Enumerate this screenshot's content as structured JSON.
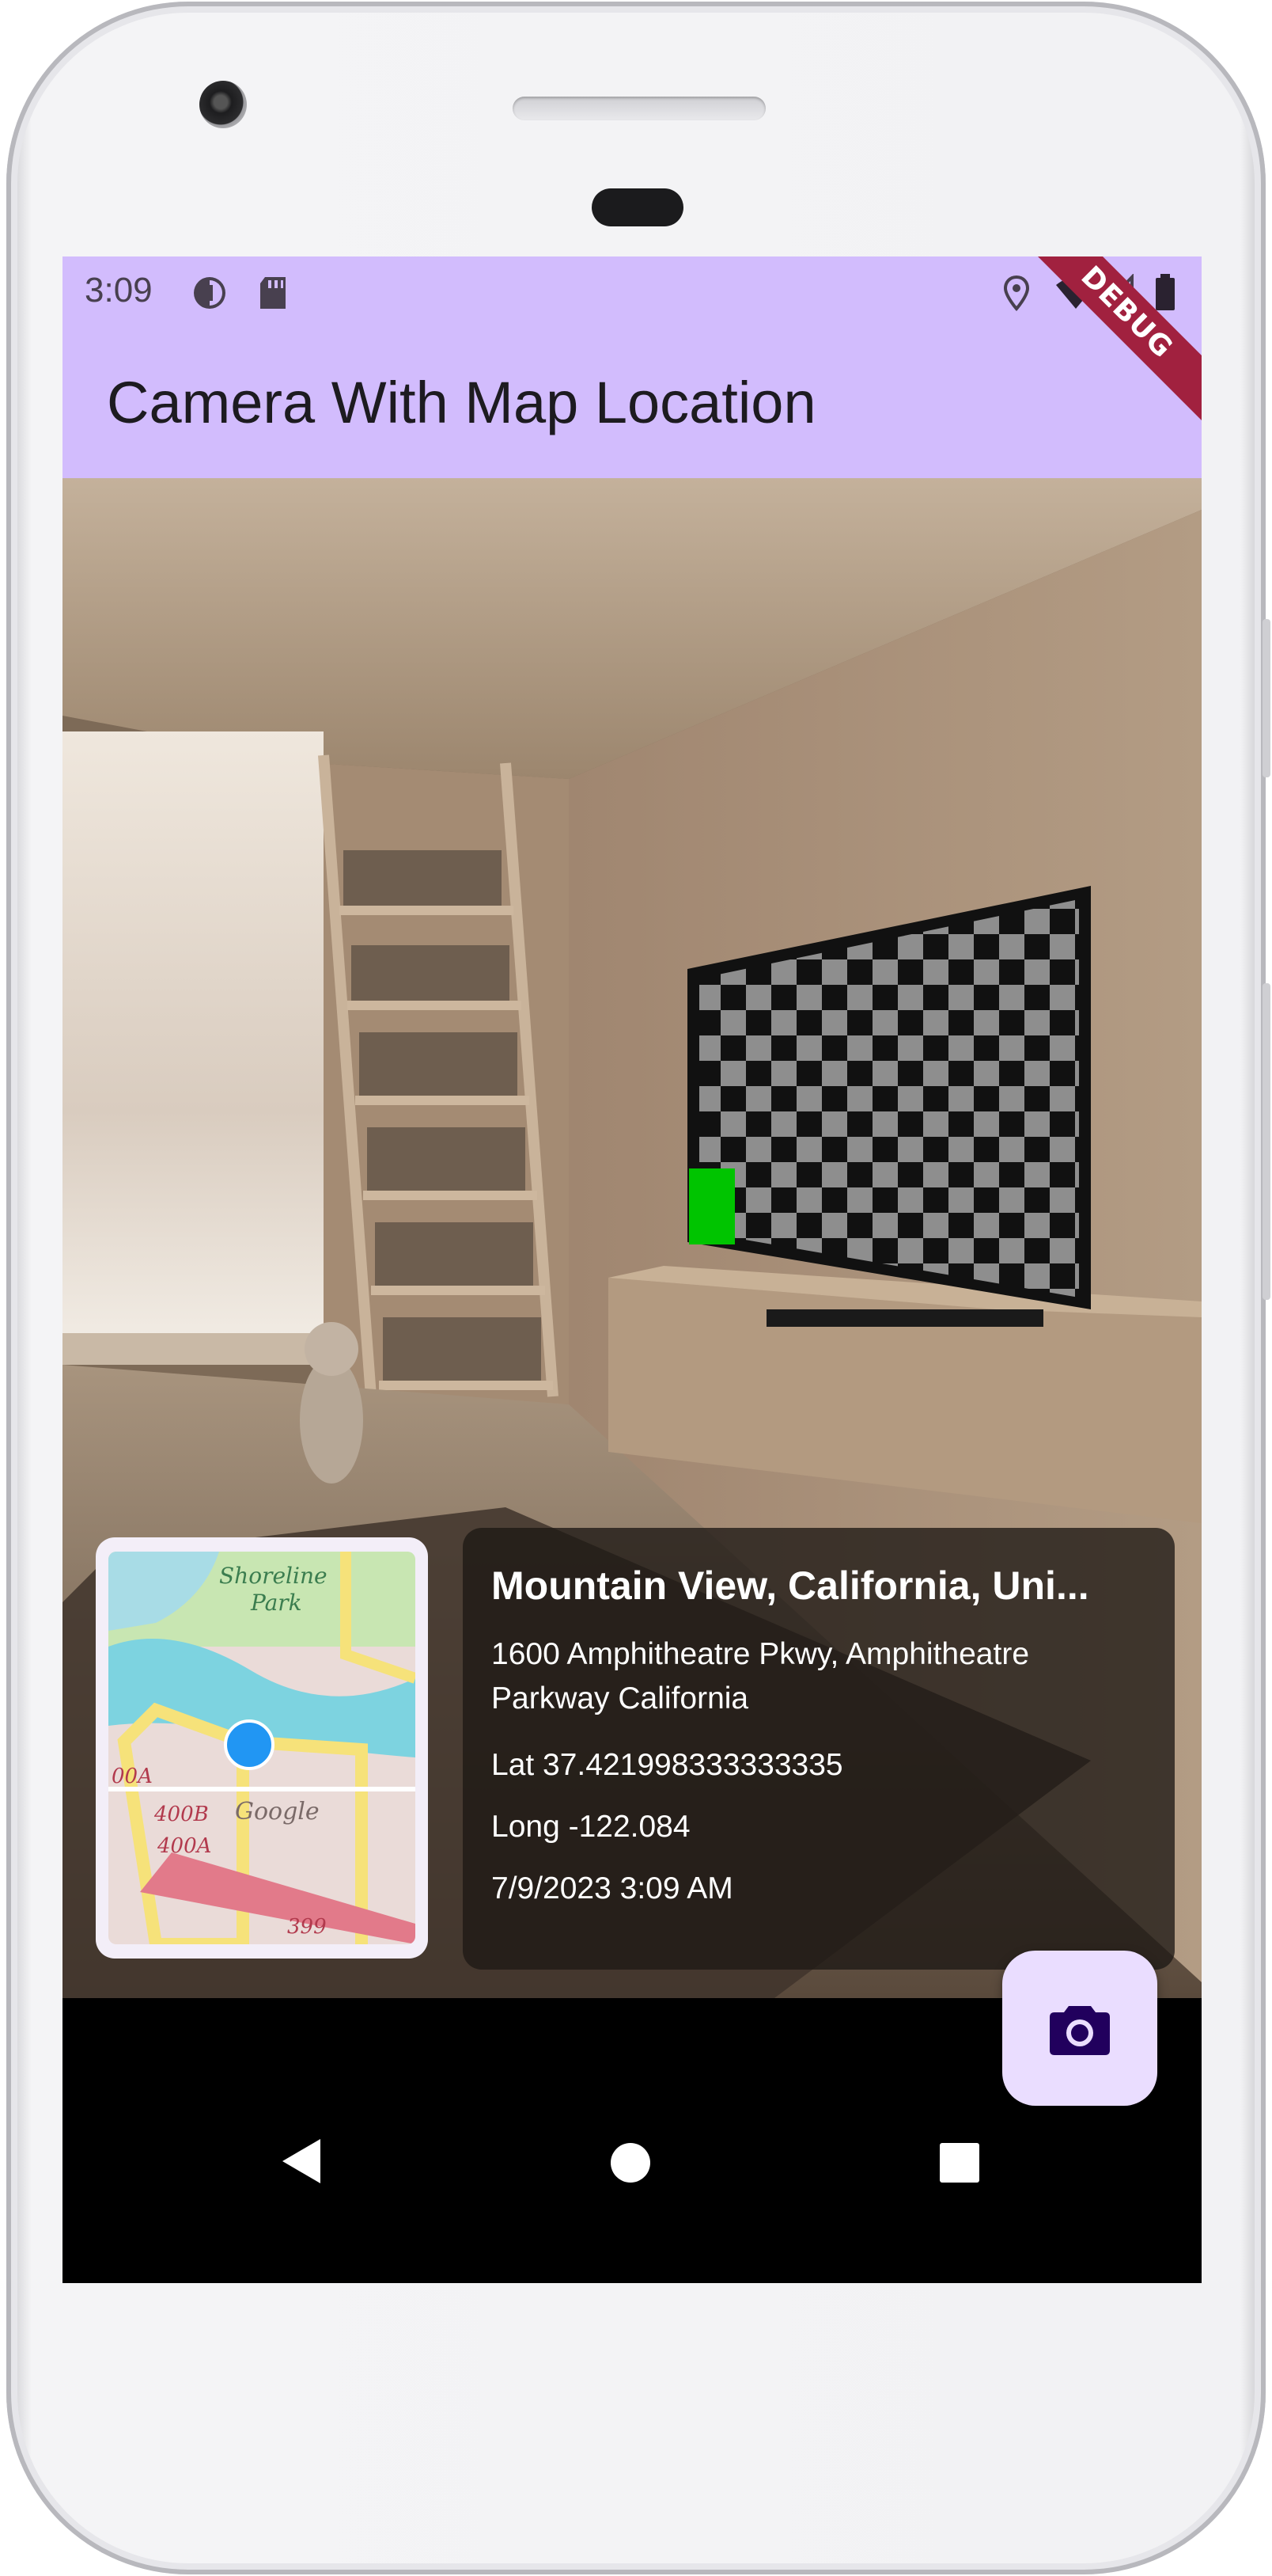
{
  "status_bar": {
    "time": "3:09",
    "left_icons": [
      "data-saver-icon",
      "sd-card-icon"
    ],
    "right_icons": [
      "location-icon",
      "wifi-icon",
      "cell-signal-icon",
      "battery-icon"
    ]
  },
  "app_bar": {
    "title": "Camera With Map Location",
    "debug_label": "DEBUG"
  },
  "map": {
    "labels": [
      "Shoreline",
      "Park",
      "Google",
      "00A",
      "400B",
      "400A",
      "399"
    ]
  },
  "location_info": {
    "place": "Mountain View, California, Uni...",
    "address": "1600 Amphitheatre Pkwy, Amphitheatre Parkway California",
    "latitude": "Lat 37.421998333333335",
    "longitude": "Long -122.084",
    "timestamp": "7/9/2023 3:09 AM"
  },
  "fab": {
    "icon": "camera-icon"
  },
  "nav": {
    "icons": [
      "back-icon",
      "home-icon",
      "recents-icon"
    ]
  },
  "colors": {
    "app_bar": "#d2bcfd",
    "fab": "#eaddff",
    "fab_icon": "#21005d",
    "debug_banner": "#a1213f",
    "map_pin": "#2196f3"
  }
}
